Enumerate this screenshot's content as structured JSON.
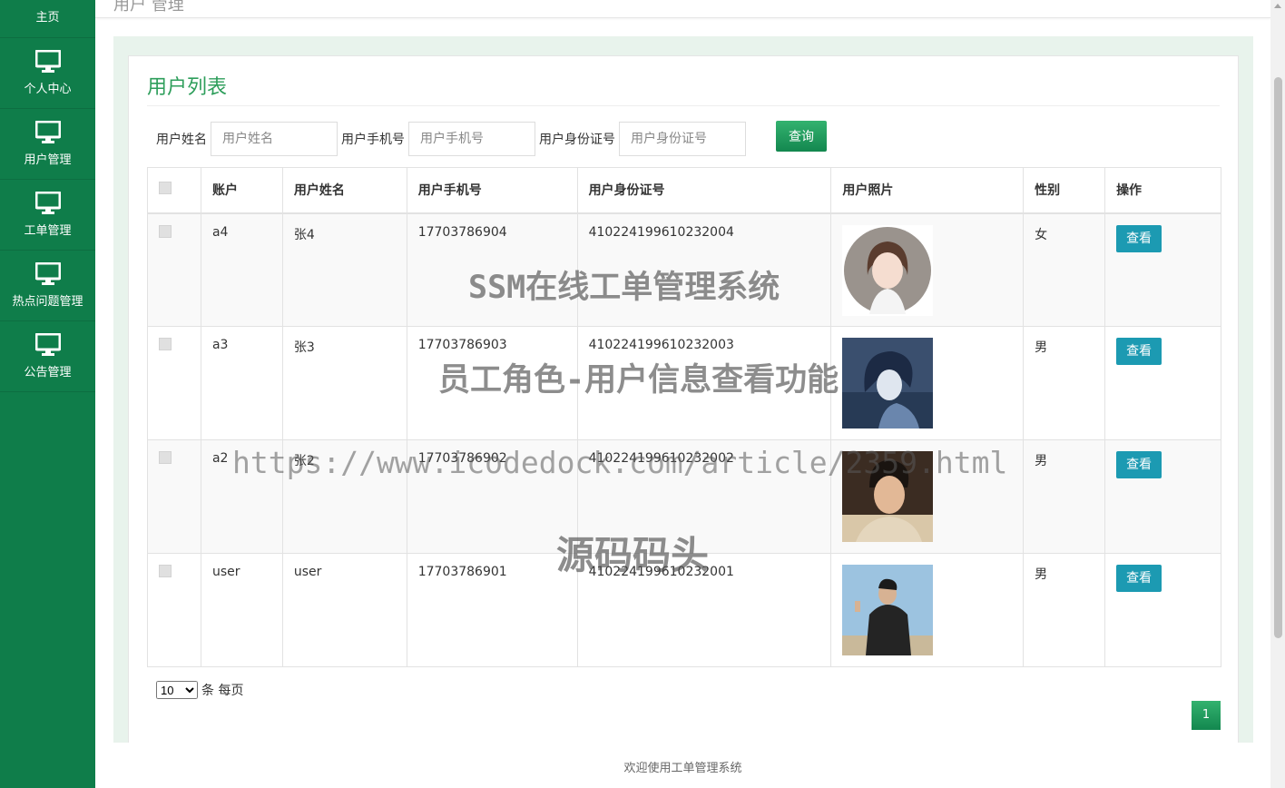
{
  "breadcrumb": "用户 管理",
  "sidebar": {
    "items": [
      {
        "label": "主页",
        "icon": "home-icon"
      },
      {
        "label": "个人中心",
        "icon": "monitor-icon"
      },
      {
        "label": "用户管理",
        "icon": "monitor-icon"
      },
      {
        "label": "工单管理",
        "icon": "monitor-icon"
      },
      {
        "label": "热点问题管理",
        "icon": "monitor-icon"
      },
      {
        "label": "公告管理",
        "icon": "monitor-icon"
      }
    ]
  },
  "panel": {
    "title": "用户列表"
  },
  "search": {
    "name_label": "用户姓名",
    "name_placeholder": "用户姓名",
    "phone_label": "用户手机号",
    "phone_placeholder": "用户手机号",
    "idcard_label": "用户身份证号",
    "idcard_placeholder": "用户身份证号",
    "button": "查询"
  },
  "table": {
    "columns": [
      "账户",
      "用户姓名",
      "用户手机号",
      "用户身份证号",
      "用户照片",
      "性别",
      "操作"
    ],
    "rows": [
      {
        "account": "a4",
        "name": "张4",
        "phone": "17703786904",
        "idcard": "410224199610232004",
        "gender": "女",
        "action": "查看"
      },
      {
        "account": "a3",
        "name": "张3",
        "phone": "17703786903",
        "idcard": "410224199610232003",
        "gender": "男",
        "action": "查看"
      },
      {
        "account": "a2",
        "name": "张2",
        "phone": "17703786902",
        "idcard": "410224199610232002",
        "gender": "男",
        "action": "查看"
      },
      {
        "account": "user",
        "name": "user",
        "phone": "17703786901",
        "idcard": "410224199610232001",
        "gender": "男",
        "action": "查看"
      }
    ]
  },
  "pager": {
    "page_size": "10",
    "suffix": "条 每页",
    "current_page": "1"
  },
  "footer": {
    "text": "欢迎使用工单管理系统"
  },
  "watermark": {
    "line1": "SSM在线工单管理系统",
    "line2": "员工角色-用户信息查看功能",
    "line3": "https://www.icodedock.com/article/2359.html",
    "line4": "源码码头"
  },
  "colors": {
    "sidebar": "#0f7d4a",
    "accent": "#2e9e5b",
    "view_button": "#1c9ab2"
  }
}
